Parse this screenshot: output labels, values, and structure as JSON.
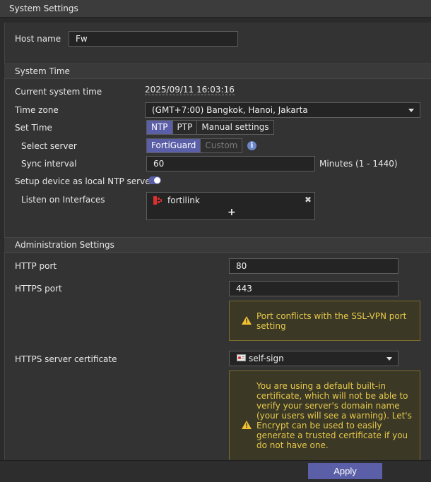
{
  "window": {
    "title": "System Settings"
  },
  "host": {
    "label": "Host name",
    "value": "Fw"
  },
  "system_time": {
    "heading": "System Time",
    "current_label": "Current system time",
    "current_value": "2025/09/11 16:03:16",
    "timezone_label": "Time zone",
    "timezone_value": "(GMT+7:00) Bangkok, Hanoi, Jakarta",
    "set_time_label": "Set Time",
    "set_time_options": [
      "NTP",
      "PTP",
      "Manual settings"
    ],
    "select_server_label": "Select server",
    "server_options": [
      "FortiGuard",
      "Custom"
    ],
    "sync_label": "Sync interval",
    "sync_value": "60",
    "sync_hint": "Minutes (1 - 1440)",
    "local_ntp_label": "Setup device as local NTP server",
    "listen_label": "Listen on Interfaces",
    "listen_interface": "fortilink",
    "add_symbol": "+",
    "remove_symbol": "✖"
  },
  "admin": {
    "heading": "Administration Settings",
    "http_label": "HTTP port",
    "http_value": "80",
    "https_label": "HTTPS port",
    "https_value": "443",
    "port_warning": "Port conflicts with the SSL-VPN port setting",
    "cert_label": "HTTPS server certificate",
    "cert_value": "self-sign",
    "cert_warning": "You are using a default built-in certificate, which will not be able to verify your server's domain name (your users will see a warning). Let's Encrypt can be used to easily generate a trusted certificate if you do not have one."
  },
  "footer": {
    "apply_label": "Apply"
  },
  "colors": {
    "accent": "#5b5fa8",
    "warning": "#f2c230",
    "background": "#2b2b2b"
  }
}
